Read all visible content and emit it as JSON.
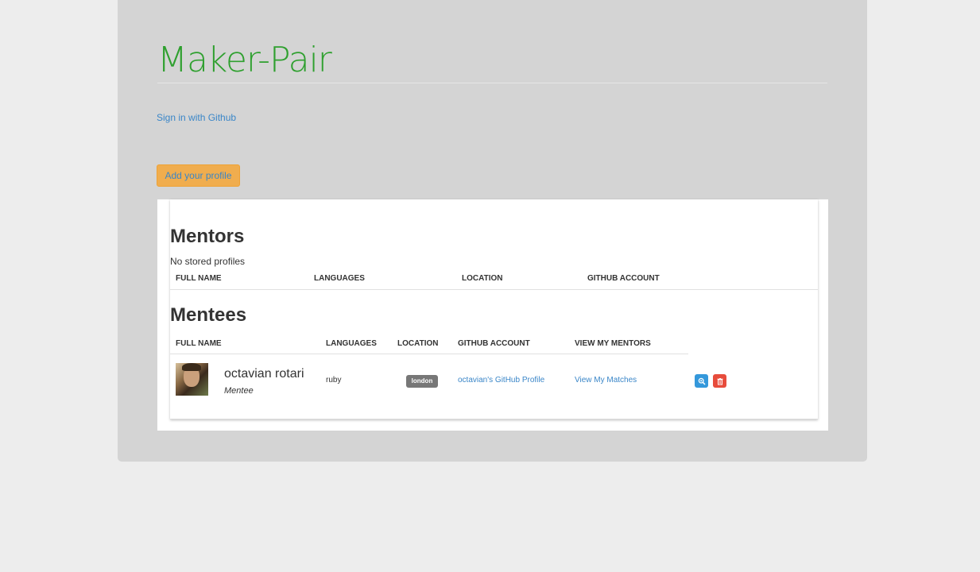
{
  "header": {
    "brand": "Maker-Pair",
    "signin_label": "Sign in with Github",
    "add_profile_label": "Add your profile"
  },
  "mentors": {
    "title": "Mentors",
    "empty_text": "No stored profiles",
    "columns": [
      "Full Name",
      "Languages",
      "Location",
      "Github Account"
    ]
  },
  "mentees": {
    "title": "Mentees",
    "columns": [
      "Full Name",
      "Languages",
      "Location",
      "Github Account",
      "View My Mentors"
    ],
    "rows": [
      {
        "name": "octavian rotari",
        "role": "Mentee",
        "language": "ruby",
        "location": "london",
        "github_link": "octavian's GitHub Profile",
        "matches_link": "View My Matches",
        "actions": [
          "zoom-icon",
          "trash-icon"
        ]
      }
    ]
  },
  "colors": {
    "brand_green": "#2fa02f",
    "link_blue": "#3a86c8",
    "warning_orange": "#f0ad4e",
    "info_blue": "#3498db",
    "danger_red": "#e74c3c",
    "badge_gray": "#777777"
  }
}
